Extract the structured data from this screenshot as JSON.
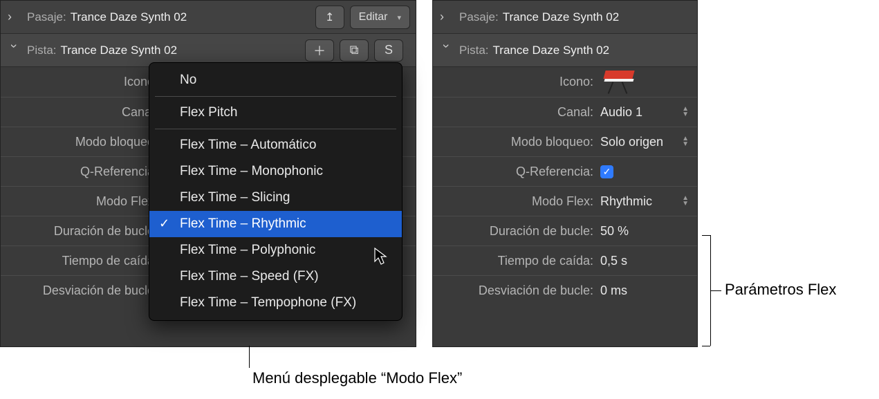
{
  "left": {
    "header": {
      "pasaje_label": "Pasaje:",
      "pasaje_value": "Trance Daze Synth 02",
      "pista_label": "Pista:",
      "pista_value": "Trance Daze Synth 02",
      "editar_label": "Editar",
      "s_label": "S"
    },
    "params": {
      "icono": "Icono",
      "canal": "Canal",
      "modo_bloqueo": "Modo bloqueo",
      "q_ref": "Q-Referencia",
      "modo_flex": "Modo Flex",
      "dur_bucle": "Duración de bucle",
      "t_caida": "Tiempo de caída",
      "desv_bucle": "Desviación de bucle"
    }
  },
  "right": {
    "header": {
      "pasaje_label": "Pasaje:",
      "pasaje_value": "Trance Daze Synth 02",
      "pista_label": "Pista:",
      "pista_value": "Trance Daze Synth 02"
    },
    "params": {
      "icono_label": "Icono:",
      "canal_label": "Canal:",
      "canal_value": "Audio 1",
      "bloqueo_label": "Modo bloqueo:",
      "bloqueo_value": "Solo origen",
      "qref_label": "Q-Referencia:",
      "flex_label": "Modo Flex:",
      "flex_value": "Rhythmic",
      "dur_label": "Duración de bucle:",
      "dur_value": "50 %",
      "caida_label": "Tiempo de caída:",
      "caida_value": "0,5 s",
      "desv_label": "Desviación de bucle:",
      "desv_value": "0 ms"
    }
  },
  "popup": {
    "items": [
      "No",
      "Flex Pitch",
      "Flex Time – Automático",
      "Flex Time – Monophonic",
      "Flex Time – Slicing",
      "Flex Time – Rhythmic",
      "Flex Time – Polyphonic",
      "Flex Time – Speed (FX)",
      "Flex Time – Tempophone (FX)"
    ],
    "selected_index": 5
  },
  "callouts": {
    "bottom": "Menú desplegable “Modo Flex”",
    "right": "Parámetros Flex"
  }
}
